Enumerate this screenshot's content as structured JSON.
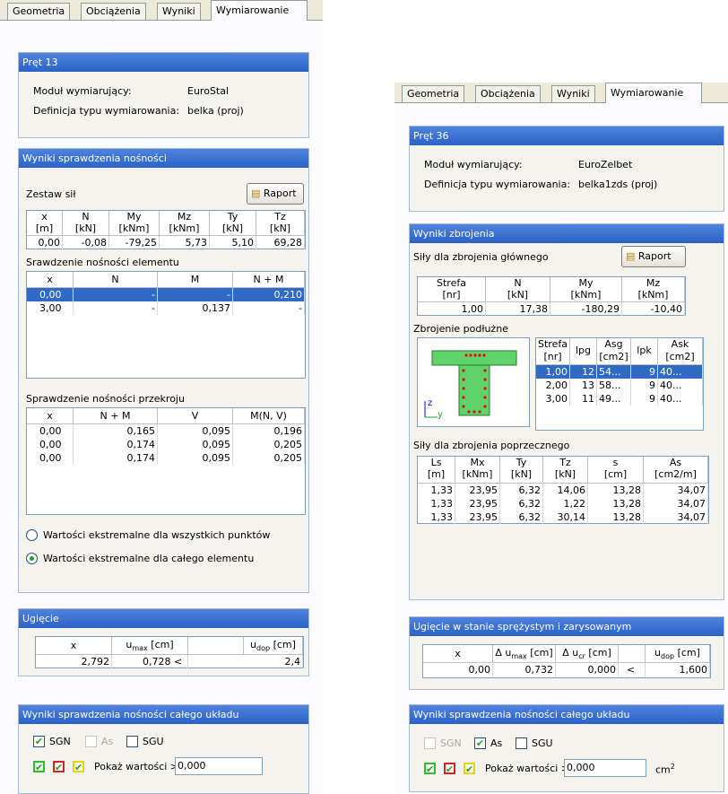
{
  "left": {
    "tabs": [
      "Geometria",
      "Obciążenia",
      "Wyniki",
      "Wymiarowanie"
    ],
    "bar_title": "Pręt 13",
    "module_label": "Moduł wymiarujący:",
    "module_value": "EuroStal",
    "def_label": "Definicja typu wymiarowania:",
    "def_value": "belka (proj)",
    "capacity_title": "Wyniki sprawdzenia nośności",
    "forces_label": "Zestaw sił",
    "raport": "Raport",
    "forces_headers": [
      "x\n[m]",
      "N\n[kN]",
      "My\n[kNm]",
      "Mz\n[kNm]",
      "Ty\n[kN]",
      "Tz\n[kN]"
    ],
    "forces_rows": [
      [
        "0,00",
        "-0,08",
        "-79,25",
        "5,73",
        "5,10",
        "69,28"
      ]
    ],
    "element_label": "Srawdzenie nośności elementu",
    "element_headers": [
      "x",
      "N",
      "M",
      "N + M"
    ],
    "element_rows": [
      [
        "0,00",
        "-",
        "-",
        "0,210"
      ],
      [
        "3,00",
        "-",
        "0,137",
        "-"
      ]
    ],
    "section_label": "Sprawdzenie nośności przekroju",
    "section_headers": [
      "x",
      "N + M",
      "V",
      "M(N, V)"
    ],
    "section_rows": [
      [
        "0,00",
        "0,165",
        "0,095",
        "0,196"
      ],
      [
        "0,00",
        "0,174",
        "0,095",
        "0,205"
      ],
      [
        "0,00",
        "0,174",
        "0,095",
        "0,205"
      ]
    ],
    "radio1": "Wartości ekstremalne dla wszystkich punktów",
    "radio2": "Wartości ekstremalne dla całego elementu",
    "defl_title": "Ugięcie",
    "defl_h_x": "x",
    "defl_h_umax": "u",
    "defl_h_umax_sub": "max",
    "defl_h_umax_unit": " [cm]",
    "defl_h_udop": "u",
    "defl_h_udop_sub": "dop",
    "defl_h_udop_unit": " [cm]",
    "defl_row": [
      "2,792",
      "0,728 <",
      "2,4"
    ],
    "system_title": "Wyniki sprawdzenia nośności całego układu",
    "cb_sgn": "SGN",
    "cb_as": "As",
    "cb_sgu": "SGU",
    "show_label": "Pokaż wartości >",
    "show_value": "0,000"
  },
  "right": {
    "tabs": [
      "Geometria",
      "Obciążenia",
      "Wyniki",
      "Wymiarowanie"
    ],
    "bar_title": "Pręt 36",
    "module_label": "Moduł wymiarujący:",
    "module_value": "EuroZelbet",
    "def_label": "Definicja typu wymiarowania:",
    "def_value": "belka1zds (proj)",
    "reinf_title": "Wyniki zbrojenia",
    "main_forces_label": "Siły dla zbrojenia głównego",
    "raport": "Raport",
    "main_headers": [
      "Strefa\n[nr]",
      "N\n[kN]",
      "My\n[kNm]",
      "Mz\n[kNm]"
    ],
    "main_rows": [
      [
        "1,00",
        "17,38",
        "-180,29",
        "-10,40"
      ]
    ],
    "long_label": "Zbrojenie podłużne",
    "long_headers": [
      "Strefa\n[nr]",
      "lpg",
      "Asg\n[cm2]",
      "lpk",
      "Ask\n[cm2]"
    ],
    "long_rows": [
      [
        "1,00",
        "12",
        "54...",
        "9",
        "40..."
      ],
      [
        "2,00",
        "13",
        "58...",
        "9",
        "40..."
      ],
      [
        "3,00",
        "11",
        "49...",
        "9",
        "40..."
      ]
    ],
    "axis_z": "z",
    "axis_y": "y",
    "trans_label": "Siły dla zbrojenia poprzecznego",
    "trans_headers": [
      "Ls\n[m]",
      "Mx\n[kNm]",
      "Ty\n[kN]",
      "Tz\n[kN]",
      "s\n[cm]",
      "As\n[cm2/m]"
    ],
    "trans_rows": [
      [
        "1,33",
        "23,95",
        "6,32",
        "14,06",
        "13,28",
        "34,07"
      ],
      [
        "1,33",
        "23,95",
        "6,32",
        "1,22",
        "13,28",
        "34,07"
      ],
      [
        "1,33",
        "23,95",
        "6,32",
        "30,14",
        "13,28",
        "34,07"
      ]
    ],
    "defl_title": "Ugięcie w stanie sprężystym i zarysowanym",
    "defl_h_x": "x",
    "defl_h_du": "Δ u",
    "defl_h_du_sub": "max",
    "defl_h_du_unit": " [cm]",
    "defl_h_ucr": "Δ u",
    "defl_h_ucr_sub": "cr",
    "defl_h_ucr_unit": " [cm]",
    "defl_h_udop": "u",
    "defl_h_udop_sub": "dop",
    "defl_h_udop_unit": " [cm]",
    "defl_row": [
      "0,00",
      "0,732",
      "0,000",
      "<",
      "1,600"
    ],
    "system_title": "Wyniki sprawdzenia nośności całego układu",
    "cb_sgn": "SGN",
    "cb_as": "As",
    "cb_sgu": "SGU",
    "show_label": "Pokaż wartości >",
    "show_value": "0,000",
    "unit": "cm",
    "unit_sup": "2"
  }
}
